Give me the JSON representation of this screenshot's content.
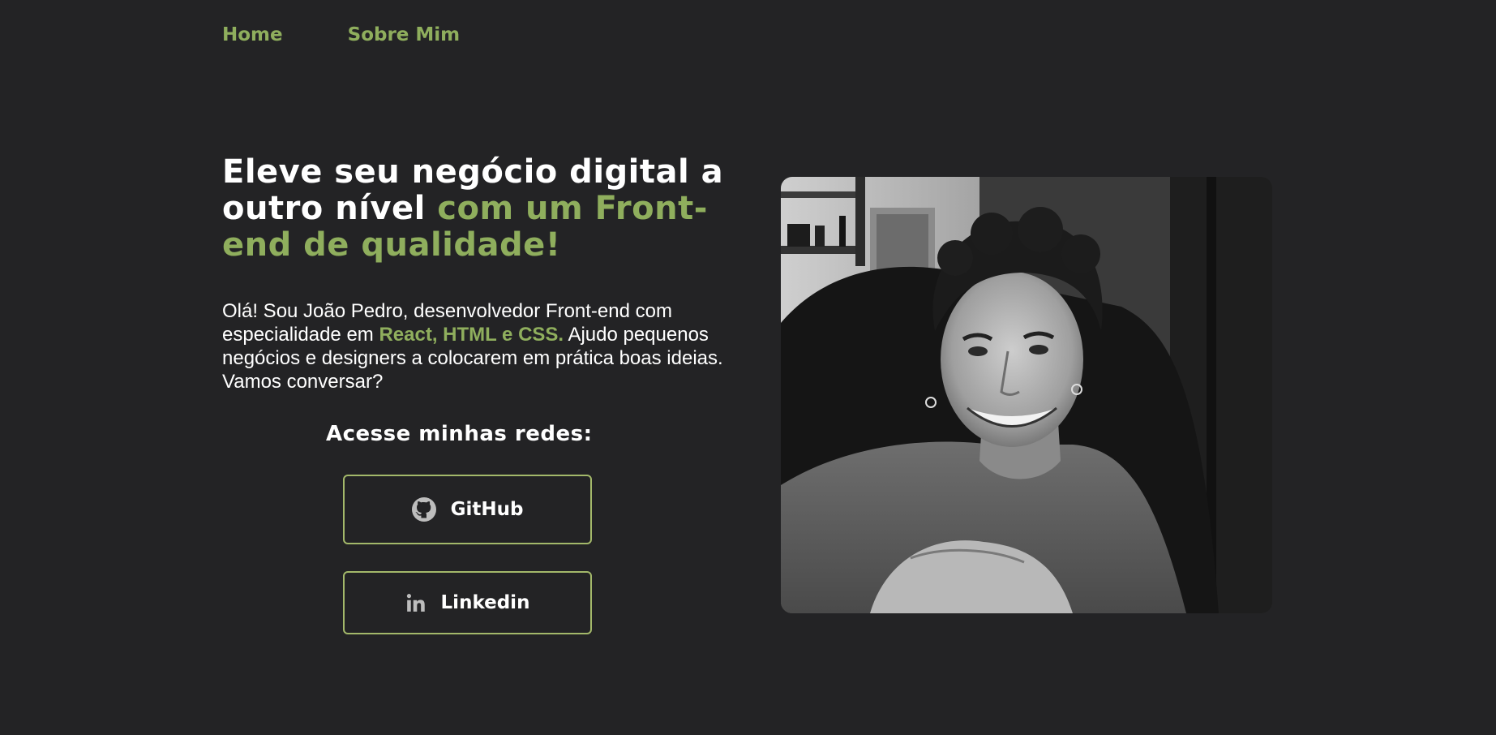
{
  "nav": {
    "items": [
      {
        "label": "Home"
      },
      {
        "label": "Sobre Mim"
      }
    ]
  },
  "hero": {
    "headline_white": "Eleve seu negócio digital a outro nível",
    "headline_accent": "com um Front-end de qualidade!",
    "intro_before": "Olá! Sou João Pedro, desenvolvedor Front-end com especialidade em",
    "intro_highlight": "React, HTML e CSS.",
    "intro_after": "Ajudo pequenos negócios e designers a colocarem em prática boas ideias. Vamos conversar?"
  },
  "socials": {
    "title": "Acesse minhas redes:",
    "github_label": "GitHub",
    "github_icon": "github-icon",
    "linkedin_label": "Linkedin",
    "linkedin_icon": "linkedin-icon"
  },
  "colors": {
    "background": "#232325",
    "accent": "#8fae5d",
    "button_border": "#a3b86a",
    "text": "#ffffff"
  }
}
